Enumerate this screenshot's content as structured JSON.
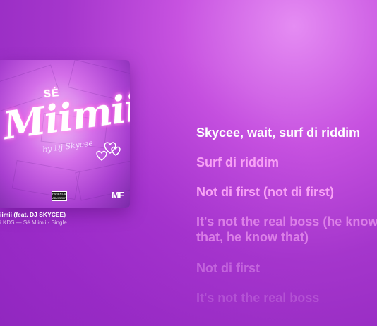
{
  "player": {
    "track": {
      "title": "iimii (feat. DJ SKYCEE)",
      "subtitle": "i KDS — Sé Miimii - Single"
    },
    "artwork": {
      "title_small": "SÉ",
      "title_big": "Miimii",
      "signature": "by Dj Skycee",
      "advisory_label": "PARENTAL ADVISORY",
      "logo": "MF",
      "colors": {
        "primary": "#d46fe9",
        "dark": "#7a2aa8",
        "light": "#f3c6f7"
      }
    }
  },
  "lyrics": {
    "lines": [
      "Skycee, wait, surf di riddim",
      "Surf di riddim",
      "Not di first (not di first)",
      "It's not the real boss (he know",
      "that, he know that)",
      "Not di first",
      "It's not the real boss"
    ],
    "active_index": 0
  },
  "theme": {
    "background": "#a536cc",
    "active_lyric": "#ffffff",
    "upcoming_lyric": "#f8a2f5"
  }
}
